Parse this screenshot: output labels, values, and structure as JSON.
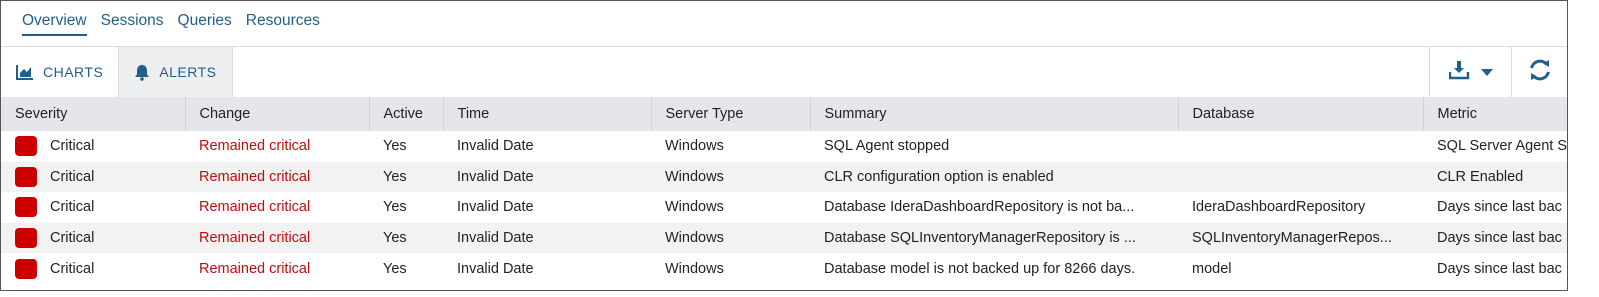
{
  "colors": {
    "accent": "#1f5f8b",
    "critical": "#cc0000",
    "change_text": "#c30d0d"
  },
  "nav": {
    "tabs": [
      {
        "label": "Overview",
        "active": true
      },
      {
        "label": "Sessions"
      },
      {
        "label": "Queries"
      },
      {
        "label": "Resources"
      }
    ]
  },
  "toolbar": {
    "charts_label": "CHARTS",
    "alerts_label": "ALERTS",
    "charts_icon": "area-chart-icon",
    "alerts_icon": "bell-icon",
    "export_icon": "download-icon",
    "refresh_icon": "refresh-icon"
  },
  "table": {
    "columns": [
      "Severity",
      "Change",
      "Active",
      "Time",
      "Server Type",
      "Summary",
      "Database",
      "Metric"
    ],
    "rows": [
      {
        "severity": "Critical",
        "change": "Remained critical",
        "active": "Yes",
        "time": "Invalid Date",
        "server_type": "Windows",
        "summary": "SQL Agent stopped",
        "database": "",
        "metric": "SQL Server Agent S"
      },
      {
        "severity": "Critical",
        "change": "Remained critical",
        "active": "Yes",
        "time": "Invalid Date",
        "server_type": "Windows",
        "summary": "CLR configuration option is enabled",
        "database": "",
        "metric": "CLR Enabled"
      },
      {
        "severity": "Critical",
        "change": "Remained critical",
        "active": "Yes",
        "time": "Invalid Date",
        "server_type": "Windows",
        "summary": "Database IderaDashboardRepository is not ba...",
        "database": "IderaDashboardRepository",
        "metric": "Days since last bac"
      },
      {
        "severity": "Critical",
        "change": "Remained critical",
        "active": "Yes",
        "time": "Invalid Date",
        "server_type": "Windows",
        "summary": "Database SQLInventoryManagerRepository is ...",
        "database": "SQLInventoryManagerRepos...",
        "metric": "Days since last bac"
      },
      {
        "severity": "Critical",
        "change": "Remained critical",
        "active": "Yes",
        "time": "Invalid Date",
        "server_type": "Windows",
        "summary": "Database model is not backed up for 8266 days.",
        "database": "model",
        "metric": "Days since last bac"
      }
    ]
  }
}
